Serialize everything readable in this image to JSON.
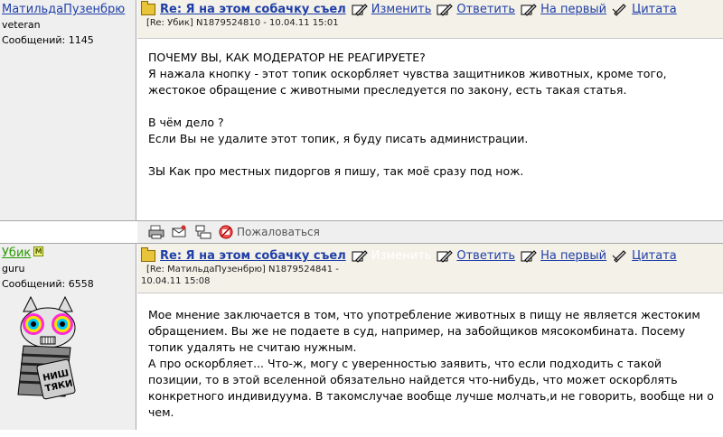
{
  "posts": [
    {
      "author": {
        "name": "МатильдаПузенбрю",
        "rank": "veteran",
        "messages": "Сообщений: 1145"
      },
      "subject": "Re: Я на этом собачку съел",
      "actions": {
        "edit": "Изменить",
        "reply": "Ответить",
        "first": "На первый",
        "quote": "Цитата"
      },
      "meta": "[Re: Убик]  N1879524810 - 10.04.11 15:01",
      "paragraphs": [
        "ПОЧЕМУ ВЫ, КАК МОДЕРАТОР НЕ РЕАГИРУЕТЕ?\nЯ нажала кнопку - этот топик оскорбляет чувства защитников животных, кроме того, жестокое обращение с животными преследуется по закону, есть такая статья.",
        "В чём дело ?\nЕсли Вы не удалите этот топик, я буду писать администрации.",
        "ЗЫ Как про местных пидоргов я пишу, так моё сразу под нож."
      ],
      "complain": "Пожаловаться"
    },
    {
      "author": {
        "name": "Убик",
        "rank": "guru",
        "messages": "Сообщений: 6558",
        "badge": "M",
        "avatar_text": "НИШ ТЯКИ"
      },
      "subject": "Re: Я на этом собачку съел",
      "actions": {
        "edit": "Изменить",
        "reply": "Ответить",
        "first": "На первый",
        "quote": "Цитата"
      },
      "meta_line1": "[Re: МатильдаПузенбрю]  N1879524841 -",
      "meta_line2": "10.04.11 15:08",
      "paragraphs": [
        "Мое мнение заключается в том, что употребление животных в пищу не является жестоким обращением. Вы же не подаете в суд, например, на забойщиков мясокомбината. Посему топик удалять не считаю нужным.\nА про оскорбляет... Что-ж, могу с уверенностью заявить, что если подходить с такой позиции, то в этой вселенной обязательно найдется что-нибудь, что может оскорблять конкретного индивидуума. В такомслучае вообще лучше молчать,и не говорить, вообще ни о чем."
      ]
    }
  ],
  "colors": {
    "link": "#1f3fa8",
    "author_green": "#2a9a00",
    "header_bg": "#f4f1e8",
    "sidebar_bg": "#efefef"
  }
}
